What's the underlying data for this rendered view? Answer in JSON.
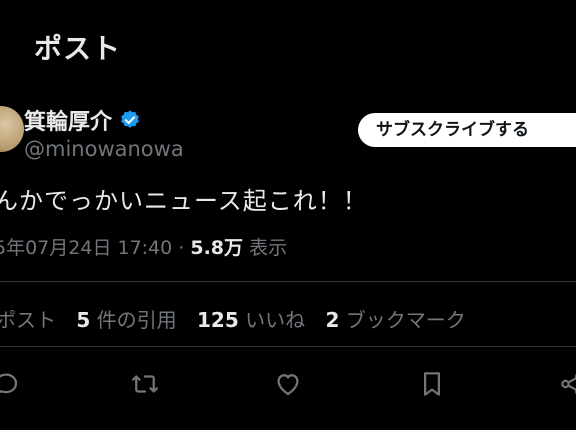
{
  "header": {
    "title": "ポスト"
  },
  "author": {
    "name": "箕輪厚介",
    "handle": "@minowanowa",
    "verified_color": "#1d9bf0"
  },
  "subscribe_button": {
    "label": "サブスクライブする"
  },
  "tweet": {
    "text": "んかでっかいニュース起これ！！",
    "timestamp": "5年07月24日 17:40 · ",
    "views": "5.8万",
    "views_label": " 表示"
  },
  "stats": {
    "reposts_label": "ポスト",
    "quotes_count": "5",
    "quotes_label": "件の引用",
    "likes_count": "125",
    "likes_label": "いいね",
    "bookmarks_count": "2",
    "bookmarks_label": "ブックマーク"
  },
  "actions": [
    {
      "icon": "reply-icon"
    },
    {
      "icon": "repost-icon"
    },
    {
      "icon": "like-icon"
    },
    {
      "icon": "bookmark-icon"
    },
    {
      "icon": "share-icon"
    }
  ],
  "colors": {
    "background": "#000000",
    "text_primary": "#e7e9ea",
    "text_secondary": "#71767b",
    "divider": "#2f3336"
  }
}
